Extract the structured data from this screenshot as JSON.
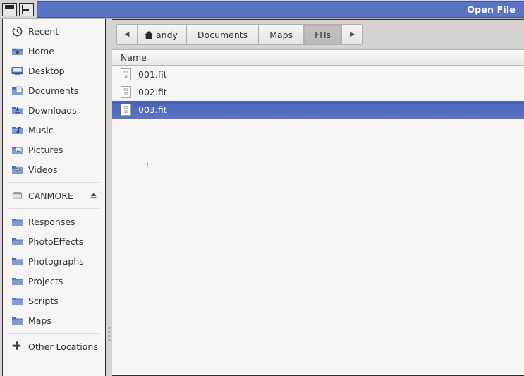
{
  "window": {
    "title": "Open File",
    "controls": [
      {
        "name": "restore-button",
        "icon": "restore-icon"
      },
      {
        "name": "split-button",
        "icon": "split-icon"
      }
    ],
    "title_color": "#5a74c4",
    "selection_color": "#4a63b4"
  },
  "sidebar": {
    "places": [
      {
        "label": "Recent",
        "icon": "recent-clock-icon"
      },
      {
        "label": "Home",
        "icon": "home-folder-icon"
      },
      {
        "label": "Desktop",
        "icon": "desktop-monitor-icon"
      },
      {
        "label": "Documents",
        "icon": "documents-folder-icon"
      },
      {
        "label": "Downloads",
        "icon": "downloads-folder-icon"
      },
      {
        "label": "Music",
        "icon": "music-folder-icon"
      },
      {
        "label": "Pictures",
        "icon": "pictures-folder-icon"
      },
      {
        "label": "Videos",
        "icon": "videos-folder-icon"
      }
    ],
    "devices": [
      {
        "label": "CANMORE",
        "icon": "drive-icon",
        "eject": "eject-icon"
      }
    ],
    "bookmarks": [
      {
        "label": "Responses",
        "icon": "folder-icon"
      },
      {
        "label": "PhotoEffects",
        "icon": "folder-icon"
      },
      {
        "label": "Photographs",
        "icon": "folder-icon"
      },
      {
        "label": "Projects",
        "icon": "folder-icon"
      },
      {
        "label": "Scripts",
        "icon": "folder-icon"
      },
      {
        "label": "Maps",
        "icon": "folder-icon"
      }
    ],
    "other": {
      "label": "Other Locations",
      "icon": "plus-icon"
    }
  },
  "pathbar": {
    "back_arrow": "◀",
    "forward_arrow": "▶",
    "crumbs": [
      {
        "label": "andy",
        "icon": "home-icon",
        "active": false
      },
      {
        "label": "Documents",
        "icon": "",
        "active": false
      },
      {
        "label": "Maps",
        "icon": "",
        "active": false
      },
      {
        "label": "FITs",
        "icon": "",
        "active": true
      }
    ]
  },
  "filelist": {
    "columns": [
      "Name"
    ],
    "rows": [
      {
        "name": "001.fit",
        "icon": "binary-file-icon",
        "selected": false
      },
      {
        "name": "002.fit",
        "icon": "binary-file-icon",
        "selected": false
      },
      {
        "name": "003.fit",
        "icon": "binary-file-icon",
        "selected": true
      }
    ],
    "binary_icon_text": {
      "top": "01",
      "bottom": "10"
    }
  }
}
